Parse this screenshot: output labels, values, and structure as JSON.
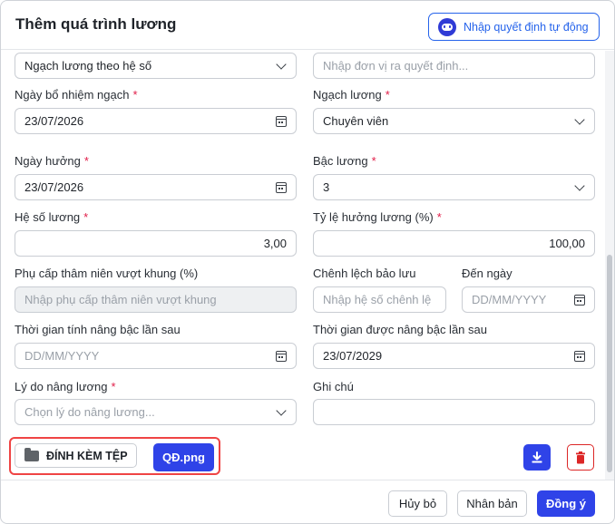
{
  "header": {
    "title": "Thêm quá trình lương",
    "auto_button_label": "Nhập quyết định tự động"
  },
  "form": {
    "salary_type_value": "Ngạch lương theo hệ số",
    "decision_unit_placeholder": "Nhập đơn vị ra quyết định...",
    "appoint_date_label": "Ngày bổ nhiệm ngạch",
    "appoint_date_value": "23/07/2026",
    "grade_label": "Ngạch lương",
    "grade_value": "Chuyên viên",
    "effective_date_label": "Ngày hưởng",
    "effective_date_value": "23/07/2026",
    "step_label": "Bậc lương",
    "step_value": "3",
    "coefficient_label": "Hệ số lương",
    "coefficient_value": "3,00",
    "rate_label": "Tỷ lệ hưởng lương (%)",
    "rate_value": "100,00",
    "seniority_label": "Phụ cấp thâm niên vượt khung (%)",
    "seniority_placeholder": "Nhập phụ cấp thâm niên vượt khung",
    "reserve_diff_label": "Chênh lệch bảo lưu",
    "reserve_diff_placeholder": "Nhập hệ số chênh lệ",
    "until_label": "Đến ngày",
    "until_placeholder": "DD/MM/YYYY",
    "next_raise_calc_label": "Thời gian tính nâng bậc lần sau",
    "next_raise_calc_placeholder": "DD/MM/YYYY",
    "next_raise_label": "Thời gian được nâng bậc lần sau",
    "next_raise_value": "23/07/2029",
    "reason_label": "Lý do nâng lương",
    "reason_placeholder": "Chọn lý do nâng lương...",
    "note_label": "Ghi chú",
    "required_mark": "*"
  },
  "attachments": {
    "attach_button_label": "ĐÍNH KÈM TỆP",
    "file_name": "QĐ.png"
  },
  "footer": {
    "cancel_label": "Hủy bỏ",
    "duplicate_label": "Nhân bản",
    "confirm_label": "Đồng ý"
  },
  "colors": {
    "primary": "#2f43e8",
    "danger": "#dc2626",
    "highlight": "#ef4444"
  }
}
